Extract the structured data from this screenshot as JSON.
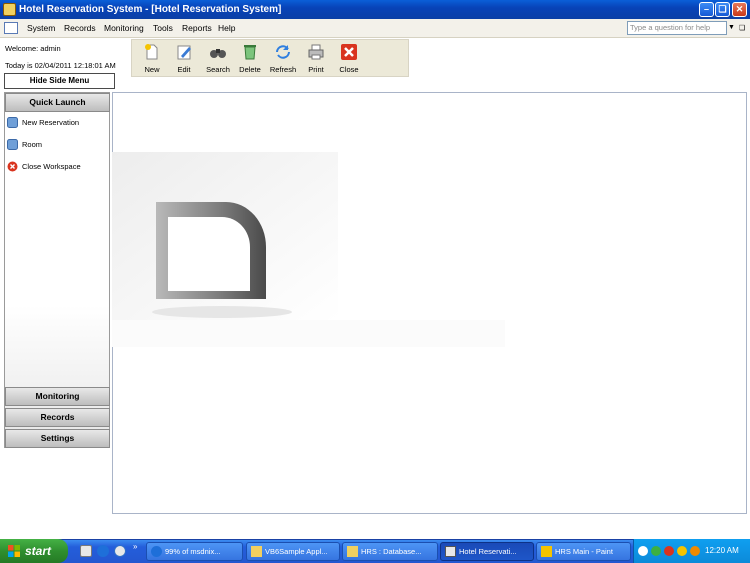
{
  "window": {
    "title": "Hotel Reservation System - [Hotel Reservation System]"
  },
  "menu": {
    "items": [
      "System",
      "Records",
      "Monitoring",
      "Tools",
      "Reports",
      "Help"
    ],
    "help_placeholder": "Type a question for help"
  },
  "status": {
    "welcome": "Welcome: admin",
    "today": "Today is 02/04/2011 12:18:01 AM",
    "hide_side_menu": "Hide Side Menu"
  },
  "toolbar": {
    "new": "New",
    "edit": "Edit",
    "search": "Search",
    "delete": "Delete",
    "refresh": "Refresh",
    "print": "Print",
    "close": "Close"
  },
  "sidebar": {
    "quick_launch": "Quick Launch",
    "items": [
      "New Reservation",
      "Room",
      "Close Workspace"
    ],
    "sections": [
      "Monitoring",
      "Records",
      "Settings"
    ]
  },
  "taskbar": {
    "start": "start",
    "tasks": [
      "99% of msdnix...",
      "VB6Sample Appl...",
      "HRS : Database...",
      "Hotel Reservati...",
      "HRS Main - Paint"
    ],
    "clock": "12:20 AM",
    "more": "»"
  },
  "colors": {
    "titlebar": "#0a4fc8",
    "taskbar": "#245edb",
    "start": "#2f8f2f",
    "close_red": "#d9341f"
  }
}
